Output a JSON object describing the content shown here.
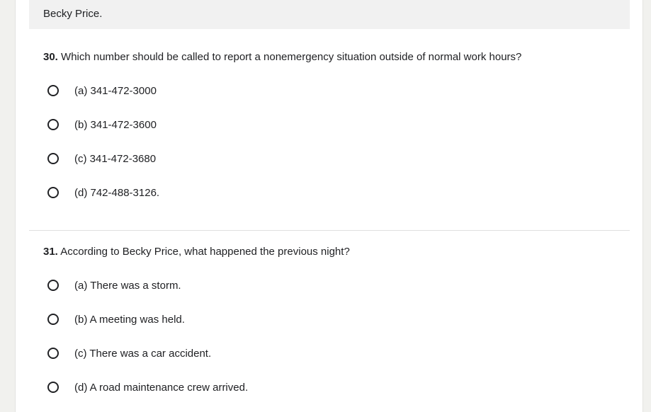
{
  "context_line": "Becky Price.",
  "questions": [
    {
      "number": "30.",
      "text": "Which number should be called to report a nonemergency situation outside of normal work hours?",
      "options": [
        "(a) 341-472-3000",
        "(b) 341-472-3600",
        "(c) 341-472-3680",
        "(d) 742-488-3126."
      ]
    },
    {
      "number": "31.",
      "text": "According to Becky Price, what happened the previous night?",
      "options": [
        "(a) There was a storm.",
        "(b) A meeting was held.",
        "(c) There was a car accident.",
        "(d) A road maintenance crew arrived."
      ]
    }
  ]
}
